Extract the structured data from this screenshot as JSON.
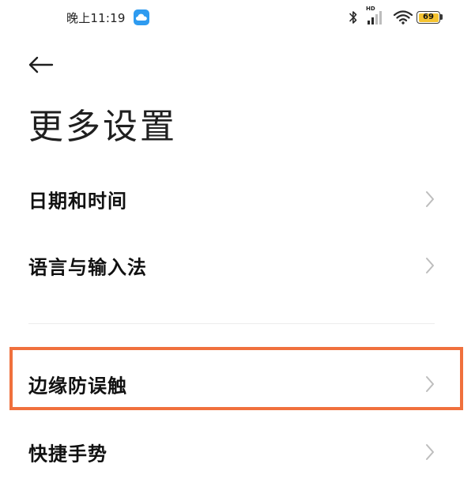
{
  "status_bar": {
    "time": "晚上11:19",
    "network_badge": "HD",
    "battery_level": "69",
    "icons": [
      "cloud-icon",
      "bluetooth-icon",
      "signal-icon",
      "wifi-icon",
      "battery-icon"
    ]
  },
  "header": {
    "back_icon": "back-arrow-icon",
    "title": "更多设置"
  },
  "settings": {
    "items": [
      {
        "label": "日期和时间"
      },
      {
        "label": "语言与输入法"
      },
      {
        "label": "边缘防误触",
        "highlighted": true
      },
      {
        "label": "快捷手势"
      }
    ]
  },
  "colors": {
    "highlight": "#f0703d",
    "battery_fill": "#f5c330",
    "cloud_badge": "#2e9bf0"
  }
}
